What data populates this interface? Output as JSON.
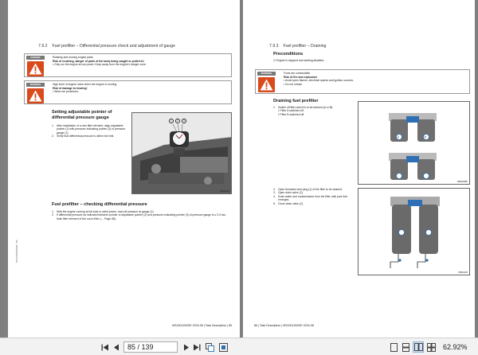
{
  "left_page": {
    "section_num": "7.9.2",
    "section_title": "Fuel prefilter – Differential pressure check and adjustment of gauge",
    "danger": {
      "label": "DANGER",
      "line1": "Rotating and moving engine parts.",
      "line2": "Risk of crushing, danger of parts of the body being caught or pulled in!",
      "bullet1": "• Only run the engine at low power. Keep away from the engine's danger zone."
    },
    "warning": {
      "label": "WARNING",
      "line1": "High level of engine noise when the engine is running.",
      "line2": "Risk of damage to hearing!",
      "bullet1": "• Wear ear protectors."
    },
    "setting_heading": "Setting adjustable pointer of differential pressure gauge",
    "setting_steps": [
      "After installation of a new filter element, align adjustable pointer (2) with pressure-indicating pointer (3) of pressure gauge (1).",
      "Verify that differential pressure is within the limit."
    ],
    "figure_callouts": [
      "1",
      "2",
      "3"
    ],
    "figure_code": "08501029",
    "checking_heading": "Fuel prefilter – checking differential pressure",
    "checking_steps": [
      "With the engine running at full load or rated power, read off pressure at gauge (1).",
      "If differential pressure as indicated between pointer of adjustable pointer (2) and pressure-indicating pointer (3) of pressure gauge is ≥ 0.3 bar, flush filter element of the out-in filter (→ Page 88)."
    ],
    "footer": "MS150119/00E 2016-08  |  Task Description  |  85",
    "side_code": "TIM-ID:0000029445 - 001"
  },
  "right_page": {
    "section_num": "7.9.3",
    "section_title": "Fuel prefilter – Draining",
    "preconditions_heading": "Preconditions",
    "precondition": "☑ Engine is stopped and starting disabled.",
    "warning": {
      "label": "WARNING",
      "line1": "Fuels are combustible.",
      "line2": "Risk of fire and explosion!",
      "bullet1": "• Avoid open flames, electrical sparks and ignition sources.",
      "bullet2": "• Do not smoke."
    },
    "draining_heading": "Draining fuel prefilter",
    "draining_steps": [
      "Switch off filter which is to be drained (A or B):",
      "Open threaded vent plug (1) of the filter to be drained.",
      "Open drain valve (2).",
      "Drain water and contaminants from the filter until pure fuel emerges.",
      "Close drain valve (2)."
    ],
    "sub_items": [
      "1  Filter A switched off",
      "2  Filter B switched off"
    ],
    "figure_codes": [
      "08500058b",
      "08501026"
    ],
    "filter_labels": [
      "A",
      "B"
    ],
    "footer": "86  |  Task Description  |  MS150119/00E 2016-08"
  },
  "toolbar": {
    "page_value": "85 / 139",
    "zoom": "62.92%"
  },
  "colors": {
    "danger_triangle": "#d94a1c",
    "viewer_bg": "#7f7f7f",
    "filter_blue": "#2f6fb3"
  }
}
